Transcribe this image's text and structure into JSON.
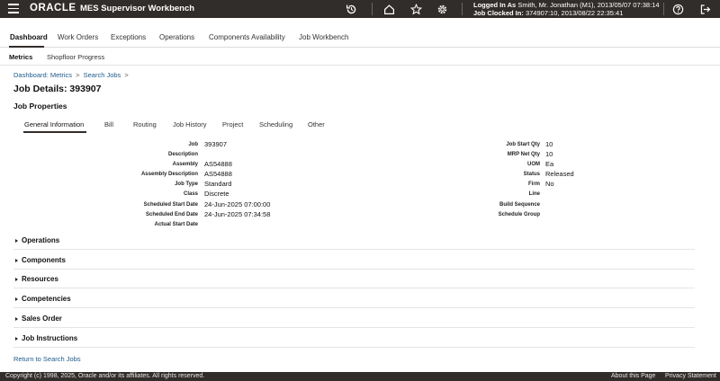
{
  "header": {
    "logo": "ORACLE",
    "app_title": "MES Supervisor Workbench",
    "logged_in_label": "Logged In As",
    "logged_in_value": "Smith, Mr. Jonathan (M1), 2013/05/07 07:38:14",
    "job_clocked_label": "Job Clocked In:",
    "job_clocked_value": "374907:10, 2013/08/22 22:35:41",
    "icons": [
      "menu-icon",
      "sync-icon",
      "home-icon",
      "favorite-star-icon",
      "settings-gear-icon",
      "help-icon",
      "sign-out-icon"
    ]
  },
  "main_tabs": [
    {
      "label": "Dashboard",
      "active": true
    },
    {
      "label": "Work Orders",
      "active": false
    },
    {
      "label": "Exceptions",
      "active": false
    },
    {
      "label": "Operations",
      "active": false
    },
    {
      "label": "Components Availability",
      "active": false
    },
    {
      "label": "Job Workbench",
      "active": false
    }
  ],
  "sub_tabs": [
    {
      "label": "Metrics",
      "active": true
    },
    {
      "label": "Shopfloor Progress",
      "active": false
    }
  ],
  "breadcrumb": [
    {
      "label": "Dashboard: Metrics"
    },
    {
      "label": "Search Jobs"
    }
  ],
  "breadcrumb_sep": ">",
  "page_title": "Job Details: 393907",
  "section_title": "Job Properties",
  "inner_tabs": [
    {
      "label": "General Information",
      "active": true
    },
    {
      "label": "Bill",
      "active": false
    },
    {
      "label": "Routing",
      "active": false
    },
    {
      "label": "Job History",
      "active": false
    },
    {
      "label": "Project",
      "active": false
    },
    {
      "label": "Scheduling",
      "active": false
    },
    {
      "label": "Other",
      "active": false
    }
  ],
  "fields_left": [
    {
      "label": "Job",
      "value": "393907"
    },
    {
      "label": "Description",
      "value": ""
    },
    {
      "label": "Assembly",
      "value": "AS54888"
    },
    {
      "label": "Assembly Description",
      "value": "AS54888"
    },
    {
      "label": "Job Type",
      "value": "Standard"
    },
    {
      "label": "Class",
      "value": "Discrete"
    },
    {
      "label": "Scheduled Start Date",
      "value": "24-Jun-2025 07:00:00"
    },
    {
      "label": "Scheduled End Date",
      "value": "24-Jun-2025 07:34:58"
    },
    {
      "label": "Actual Start Date",
      "value": ""
    }
  ],
  "fields_right": [
    {
      "label": "Job Start Qty",
      "value": "10"
    },
    {
      "label": "MRP Net Qty",
      "value": "10"
    },
    {
      "label": "UOM",
      "value": "Ea"
    },
    {
      "label": "Status",
      "value": "Released"
    },
    {
      "label": "Firm",
      "value": "No"
    },
    {
      "label": "Line",
      "value": ""
    },
    {
      "label": "Build Sequence",
      "value": ""
    },
    {
      "label": "Schedule Group",
      "value": ""
    }
  ],
  "accordions": [
    {
      "label": "Operations"
    },
    {
      "label": "Components"
    },
    {
      "label": "Resources"
    },
    {
      "label": "Competencies"
    },
    {
      "label": "Sales Order"
    },
    {
      "label": "Job Instructions"
    }
  ],
  "return_link": "Return to Search Jobs",
  "footer": {
    "copyright": "Copyright (c) 1998, 2025, Oracle and/or its affiliates. All rights reserved.",
    "about": "About this Page",
    "privacy": "Privacy Statement"
  }
}
